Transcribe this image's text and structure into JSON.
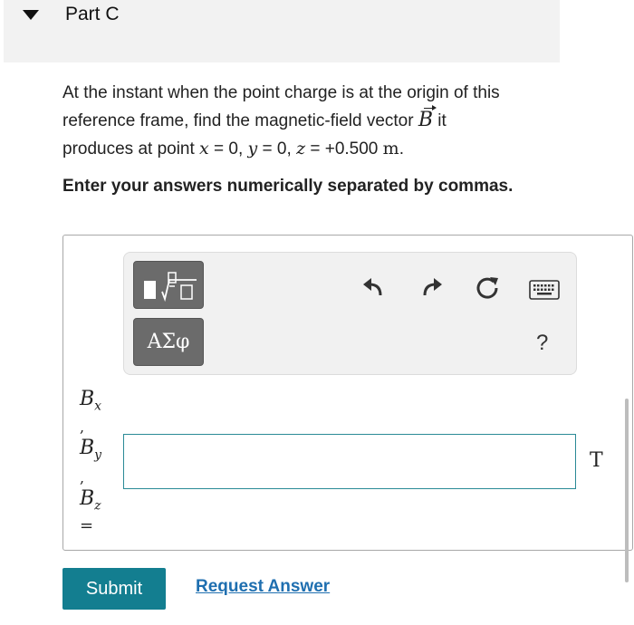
{
  "part": {
    "title": "Part C"
  },
  "question": {
    "line1": "At the instant when the point charge is at the origin of this",
    "line2_pre": "reference frame, find the magnetic-field vector",
    "vector_symbol": "B",
    "line2_post": " it",
    "line3_pre": "produces at point ",
    "x_var": "x",
    "x_val": " = 0, ",
    "y_var": "y",
    "y_val": " = 0, ",
    "z_var": "z",
    "z_val": " = +0.500 ",
    "unit": "m",
    "period": "."
  },
  "instruction": "Enter your answers numerically separated by commas.",
  "toolbar": {
    "greek_label": "ΑΣφ",
    "help_label": "?"
  },
  "answer": {
    "labels": [
      {
        "base": "B",
        "sub": "x",
        "sep": ","
      },
      {
        "base": "B",
        "sub": "y",
        "sep": ","
      },
      {
        "base": "B",
        "sub": "z",
        "sep": "="
      }
    ],
    "value": "",
    "unit": "T"
  },
  "actions": {
    "submit_label": "Submit",
    "request_label": "Request Answer"
  }
}
